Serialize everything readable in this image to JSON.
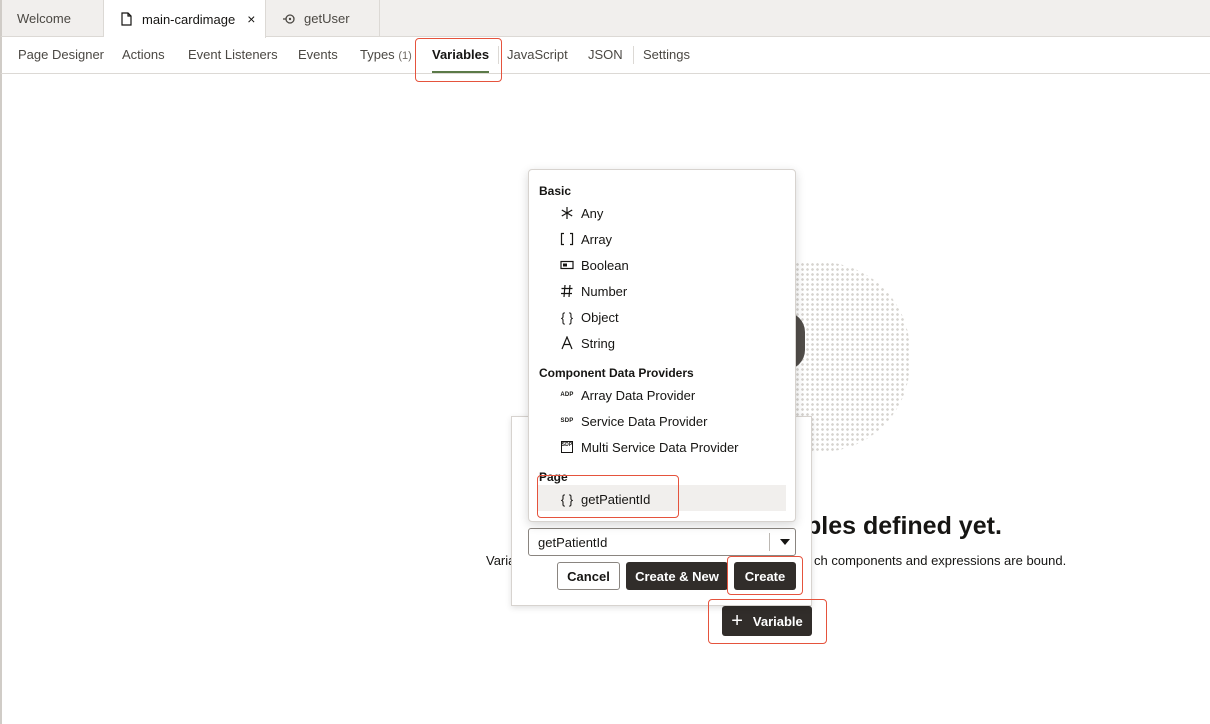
{
  "editor_tabs": [
    {
      "label": "Welcome"
    },
    {
      "label": "main-cardimage",
      "close": "×"
    },
    {
      "label": "getUser"
    }
  ],
  "subnav": {
    "page_designer": "Page Designer",
    "actions": "Actions",
    "event_listeners": "Event Listeners",
    "events": "Events",
    "types": "Types",
    "types_count": "(1)",
    "variables": "Variables",
    "javascript": "JavaScript",
    "json": "JSON",
    "settings": "Settings"
  },
  "empty_state": {
    "title_visible": "bles defined yet.",
    "desc_left": "Varia",
    "desc_right": "ch components and expressions are bound.",
    "variable_button": "Variable"
  },
  "create_popup": {
    "name_value": "getPatientId",
    "cancel": "Cancel",
    "create_new": "Create & New",
    "create": "Create"
  },
  "dropdown": {
    "groups": {
      "basic": "Basic",
      "component_data_providers": "Component Data Providers",
      "page": "Page"
    },
    "basic_items": [
      {
        "label": "Any",
        "icon": "asterisk-icon"
      },
      {
        "label": "Array",
        "icon": "brackets-icon"
      },
      {
        "label": "Boolean",
        "icon": "boolean-icon"
      },
      {
        "label": "Number",
        "icon": "hash-icon"
      },
      {
        "label": "Object",
        "icon": "braces-icon"
      },
      {
        "label": "String",
        "icon": "string-icon"
      }
    ],
    "provider_items": [
      {
        "label": "Array Data Provider",
        "icon_text": "ADP"
      },
      {
        "label": "Service Data Provider",
        "icon_text": "SDP"
      },
      {
        "label": "Multi Service Data Provider",
        "icon_text": "SDP"
      }
    ],
    "page_items": [
      {
        "label": "getPatientId",
        "icon": "braces-icon"
      }
    ]
  },
  "colors": {
    "accent_underline": "#5b7a48",
    "dark_button": "#312d2a",
    "highlight": "#e5533d"
  }
}
